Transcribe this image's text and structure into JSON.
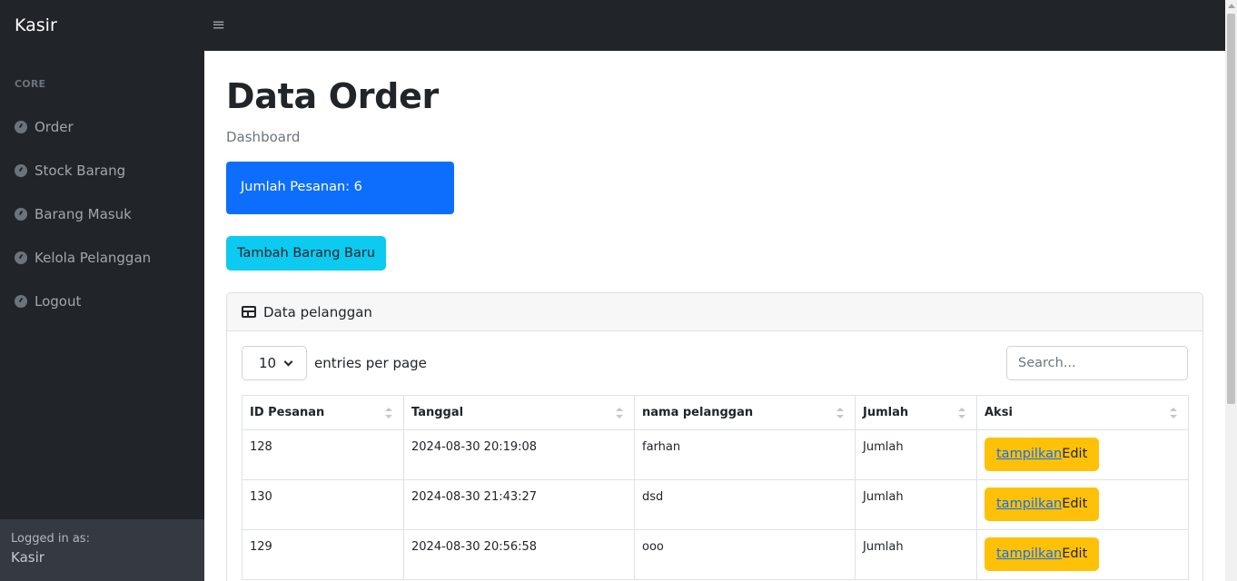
{
  "navbar": {
    "brand": "Kasir",
    "toggle_icon": "≡"
  },
  "sidebar": {
    "heading": "CORE",
    "items": [
      {
        "label": "Order",
        "icon": "gauge-icon"
      },
      {
        "label": "Stock Barang",
        "icon": "gauge-icon"
      },
      {
        "label": "Barang Masuk",
        "icon": "gauge-icon"
      },
      {
        "label": "Kelola Pelanggan",
        "icon": "gauge-icon"
      },
      {
        "label": "Logout",
        "icon": "gauge-icon"
      }
    ],
    "footer": {
      "label": "Logged in as:",
      "user": "Kasir"
    }
  },
  "main": {
    "title": "Data Order",
    "breadcrumb": "Dashboard",
    "stat_card": "Jumlah Pesanan: 6",
    "add_button": "Tambah Barang Baru",
    "card": {
      "title": "Data pelanggan",
      "per_page_value": "10",
      "per_page_label": "entries per page",
      "search_placeholder": "Search...",
      "columns": [
        "ID Pesanan",
        "Tanggal",
        "nama pelanggan",
        "Jumlah",
        "Aksi"
      ],
      "rows": [
        {
          "id": "128",
          "tanggal": "2024-08-30 20:19:08",
          "nama": "farhan",
          "jumlah": "Jumlah",
          "show": "tampilkan",
          "edit": "Edit"
        },
        {
          "id": "130",
          "tanggal": "2024-08-30 21:43:27",
          "nama": "dsd",
          "jumlah": "Jumlah",
          "show": "tampilkan",
          "edit": "Edit"
        },
        {
          "id": "129",
          "tanggal": "2024-08-30 20:56:58",
          "nama": "ooo",
          "jumlah": "Jumlah",
          "show": "tampilkan",
          "edit": "Edit"
        }
      ]
    }
  },
  "colors": {
    "sidebar_bg": "#212529",
    "primary": "#0d6efd",
    "info": "#0dcaf0",
    "warning": "#ffc107"
  }
}
